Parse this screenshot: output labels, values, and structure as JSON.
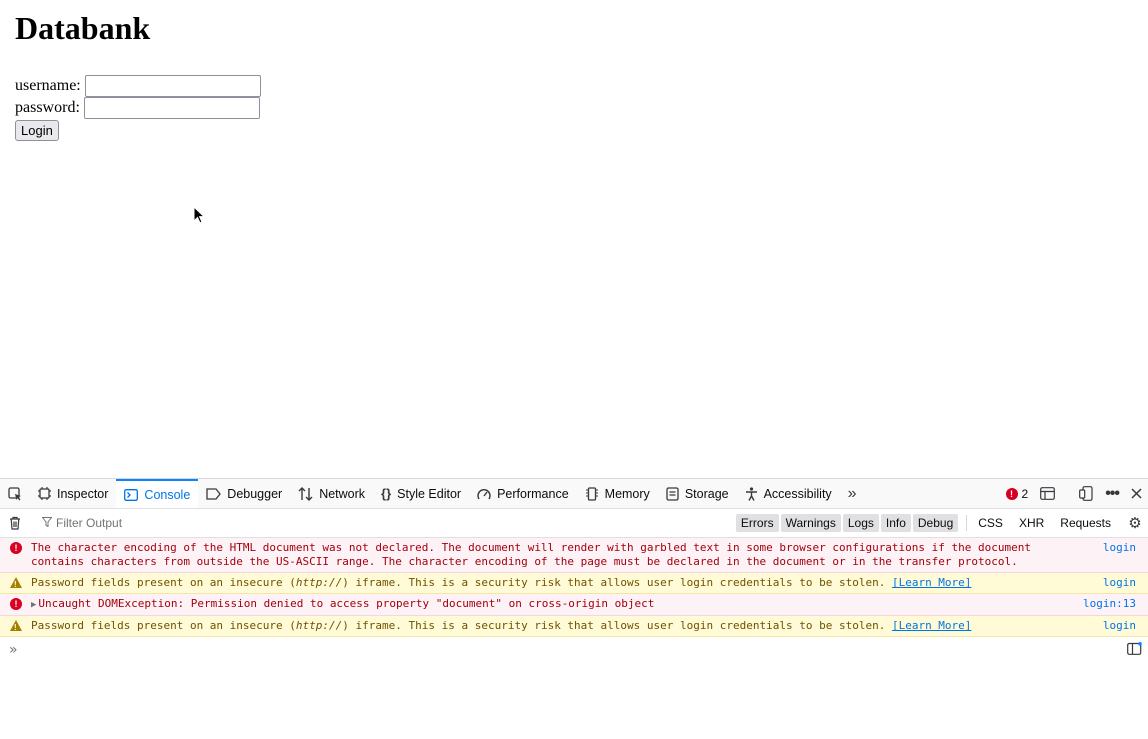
{
  "page": {
    "title": "Databank",
    "username_label": "username:",
    "password_label": "password:",
    "username_value": "",
    "password_value": "",
    "login_label": "Login"
  },
  "devtools": {
    "tabs": [
      {
        "label": "Inspector",
        "icon": "inspector-icon"
      },
      {
        "label": "Console",
        "icon": "console-icon"
      },
      {
        "label": "Debugger",
        "icon": "debugger-icon"
      },
      {
        "label": "Network",
        "icon": "network-icon"
      },
      {
        "label": "Style Editor",
        "icon": "style-editor-icon"
      },
      {
        "label": "Performance",
        "icon": "performance-icon"
      },
      {
        "label": "Memory",
        "icon": "memory-icon"
      },
      {
        "label": "Storage",
        "icon": "storage-icon"
      },
      {
        "label": "Accessibility",
        "icon": "accessibility-icon"
      }
    ],
    "active_tab": "Console",
    "error_count": "2",
    "filter_placeholder": "Filter Output",
    "filter_buttons": [
      "Errors",
      "Warnings",
      "Logs",
      "Info",
      "Debug"
    ],
    "request_buttons": [
      "CSS",
      "XHR",
      "Requests"
    ],
    "messages": [
      {
        "level": "error",
        "text": "The character encoding of the HTML document was not declared. The document will render with garbled text in some browser configurations if the document contains characters from outside the US-ASCII range. The character encoding of the page must be declared in the document or in the transfer protocol.",
        "source": "login"
      },
      {
        "level": "warn",
        "text_before": "Password fields present on an insecure (",
        "text_italic": "http://",
        "text_after": ") iframe. This is a security risk that allows user login credentials to be stolen. ",
        "link": "[Learn More]",
        "source": "login"
      },
      {
        "level": "error",
        "text": "Uncaught DOMException: Permission denied to access property \"document\" on cross-origin object",
        "source": "login:13"
      },
      {
        "level": "warn",
        "text_before": "Password fields present on an insecure (",
        "text_italic": "http://",
        "text_after": ") iframe. This is a security risk that allows user login credentials to be stolen. ",
        "link": "[Learn More]",
        "source": "login"
      }
    ],
    "colors": {
      "accent": "#0074e8",
      "error_bg": "#fdf2f5",
      "error_text": "#a4000f",
      "warn_bg": "#fffbd6",
      "warn_text": "#715100"
    }
  }
}
